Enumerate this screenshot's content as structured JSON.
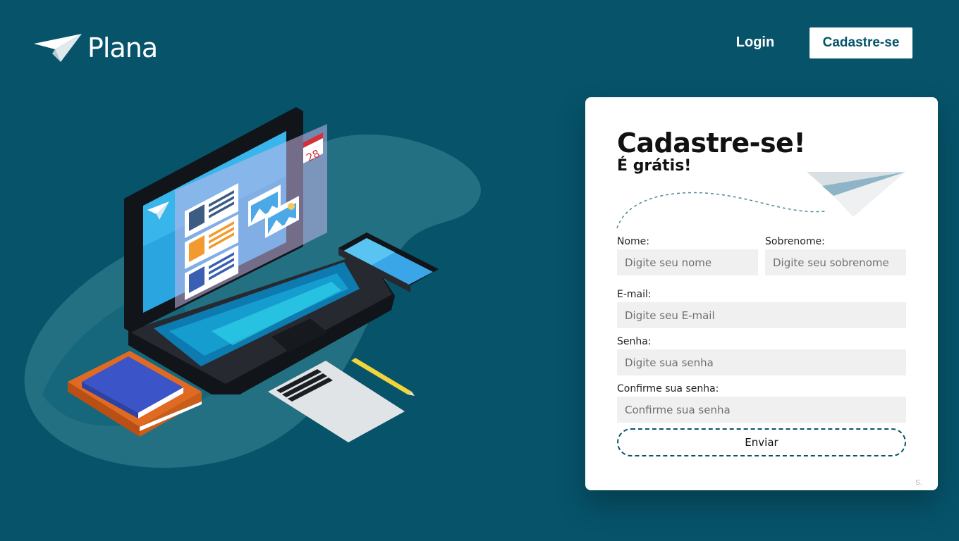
{
  "header": {
    "brand": "Plana",
    "nav_login": "Login",
    "nav_signup": "Cadastre-se"
  },
  "form": {
    "title": "Cadastre-se!",
    "subtitle": "É grátis!",
    "fields": {
      "nome": {
        "label": "Nome:",
        "placeholder": "Digite seu nome",
        "value": ""
      },
      "sobrenome": {
        "label": "Sobrenome:",
        "placeholder": "Digite seu sobrenome",
        "value": ""
      },
      "email": {
        "label": "E-mail:",
        "placeholder": "Digite seu E-mail",
        "value": ""
      },
      "senha": {
        "label": "Senha:",
        "placeholder": "Digite sua senha",
        "value": ""
      },
      "confirma": {
        "label": "Confirme sua senha:",
        "placeholder": "Confirme sua senha",
        "value": ""
      }
    },
    "submit_label": "Enviar",
    "footnote": "S."
  },
  "illustration": {
    "calendar_day": "28"
  },
  "colors": {
    "background": "#06536a",
    "card": "#ffffff",
    "input_bg": "#f0f0f0",
    "accent": "#06536a"
  },
  "icons": [
    "paper-plane-icon",
    "calendar-icon",
    "image-icon"
  ]
}
